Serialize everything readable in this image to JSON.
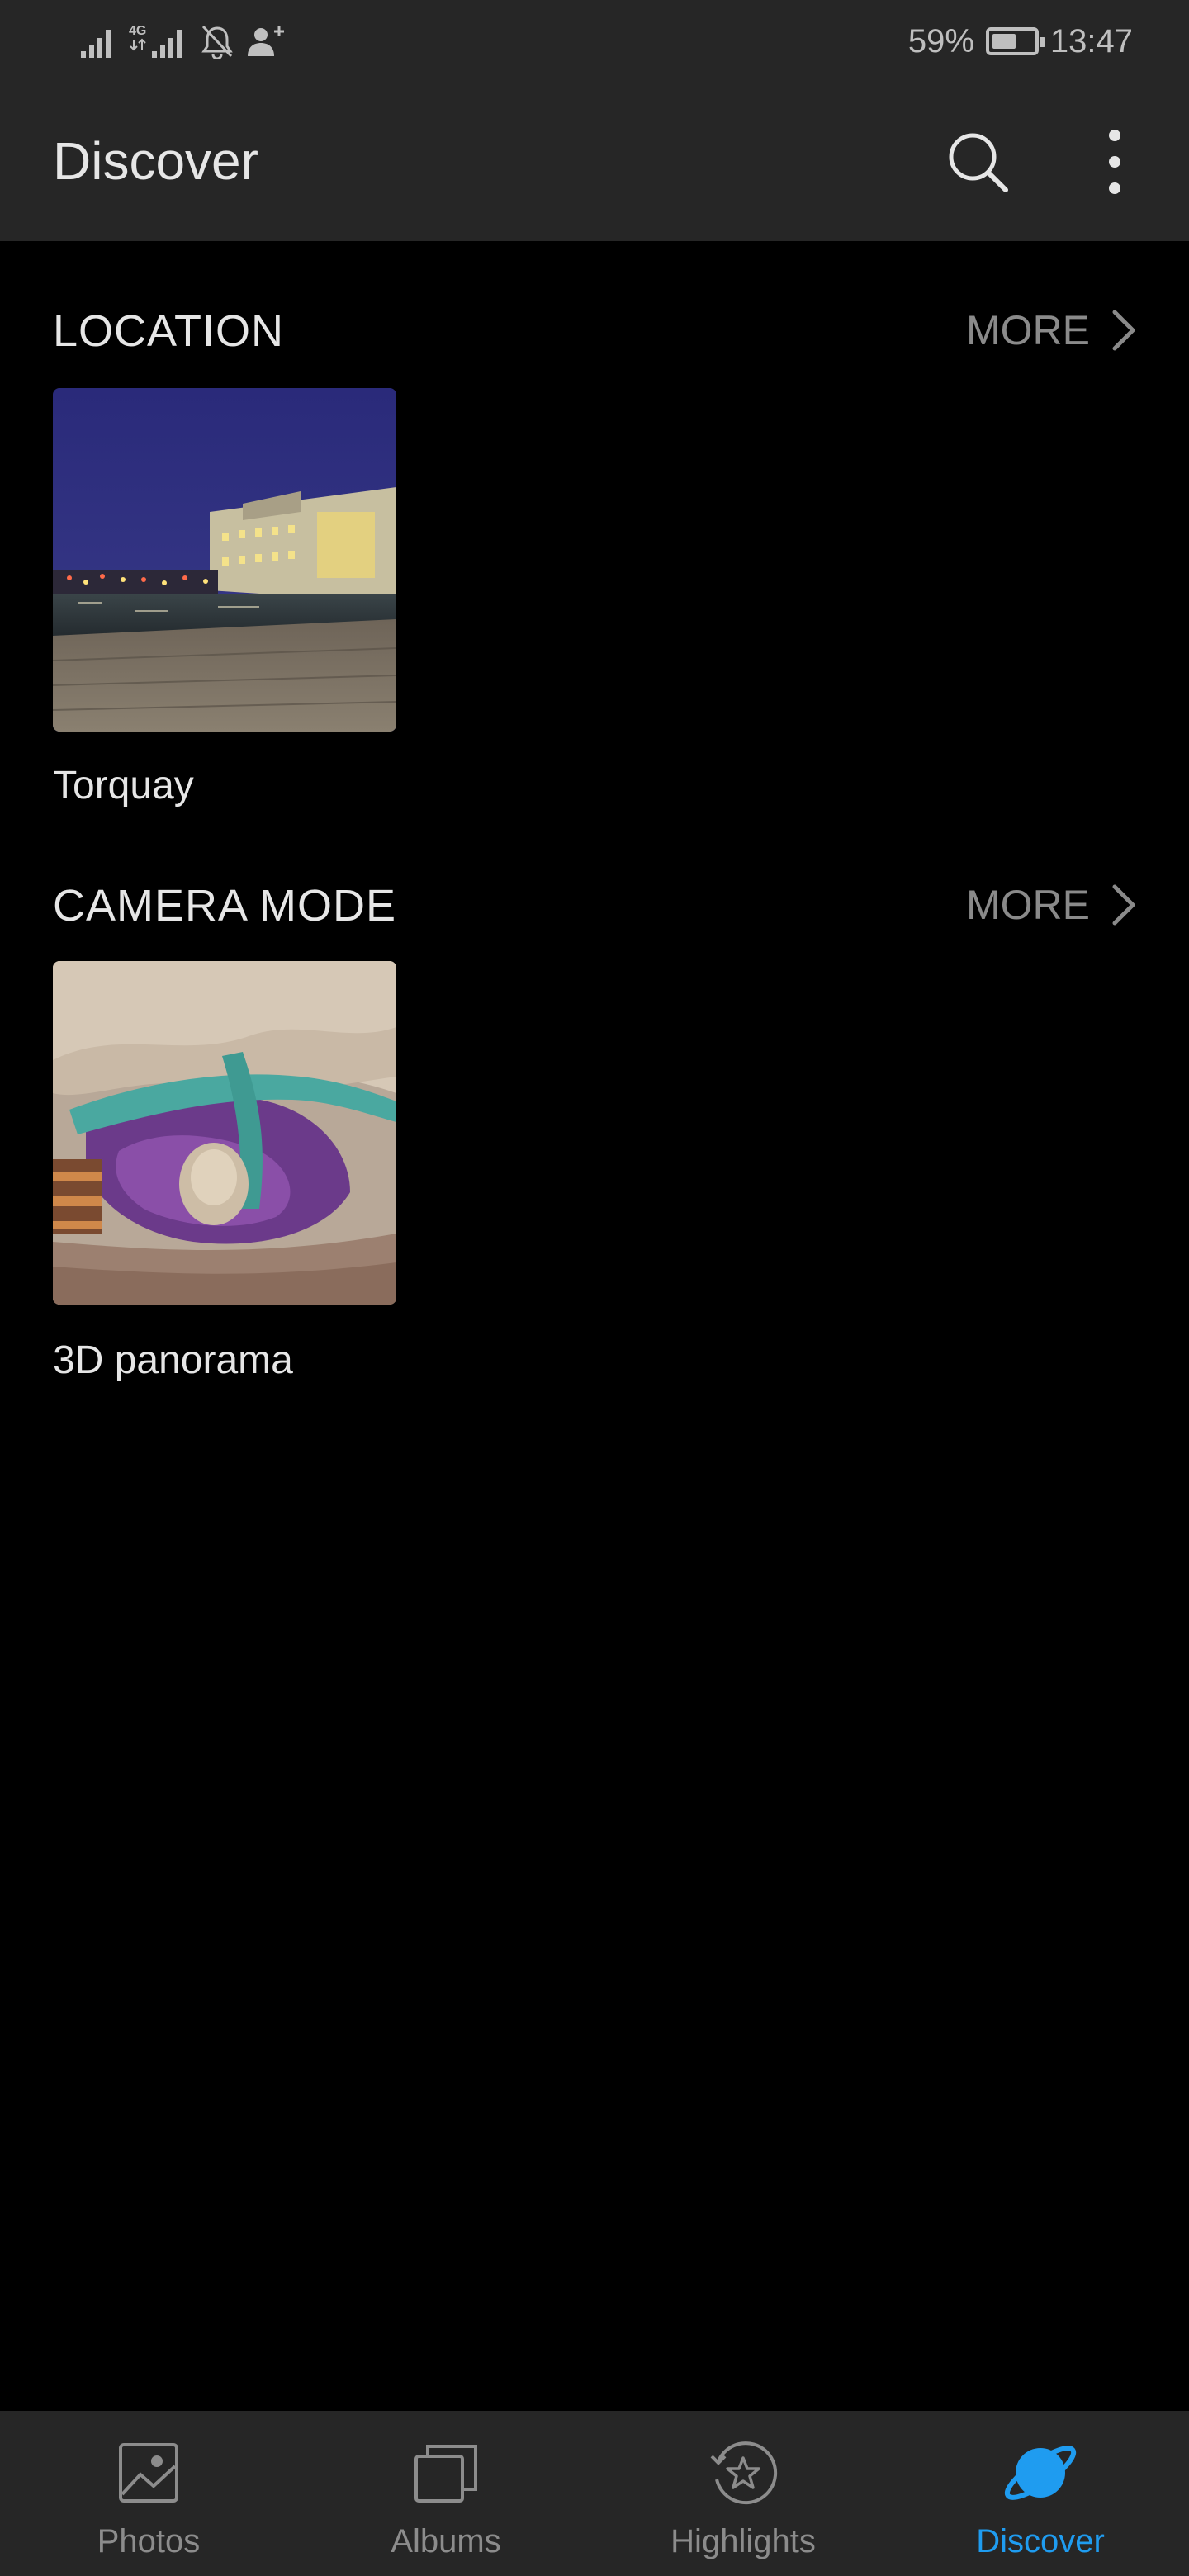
{
  "status_bar": {
    "battery_percent": "59%",
    "time": "13:47",
    "battery_level": 0.59,
    "icons": [
      "signal-icon",
      "4g-signal-icon",
      "bell-muted-icon",
      "add-person-icon"
    ]
  },
  "app_bar": {
    "title": "Discover",
    "actions": [
      "search-icon",
      "more-vert-icon"
    ]
  },
  "sections": [
    {
      "title": "LOCATION",
      "more_label": "MORE",
      "items": [
        {
          "label": "Torquay"
        }
      ]
    },
    {
      "title": "CAMERA MODE",
      "more_label": "MORE",
      "items": [
        {
          "label": "3D panorama"
        }
      ]
    }
  ],
  "bottom_nav": {
    "items": [
      {
        "label": "Photos",
        "icon": "photos-icon",
        "active": false
      },
      {
        "label": "Albums",
        "icon": "albums-icon",
        "active": false
      },
      {
        "label": "Highlights",
        "icon": "highlights-icon",
        "active": false
      },
      {
        "label": "Discover",
        "icon": "discover-icon",
        "active": true
      }
    ]
  },
  "colors": {
    "bar_background": "#262626",
    "page_background": "#000000",
    "accent": "#1f9cf0",
    "muted_text": "#8c8c8c"
  }
}
